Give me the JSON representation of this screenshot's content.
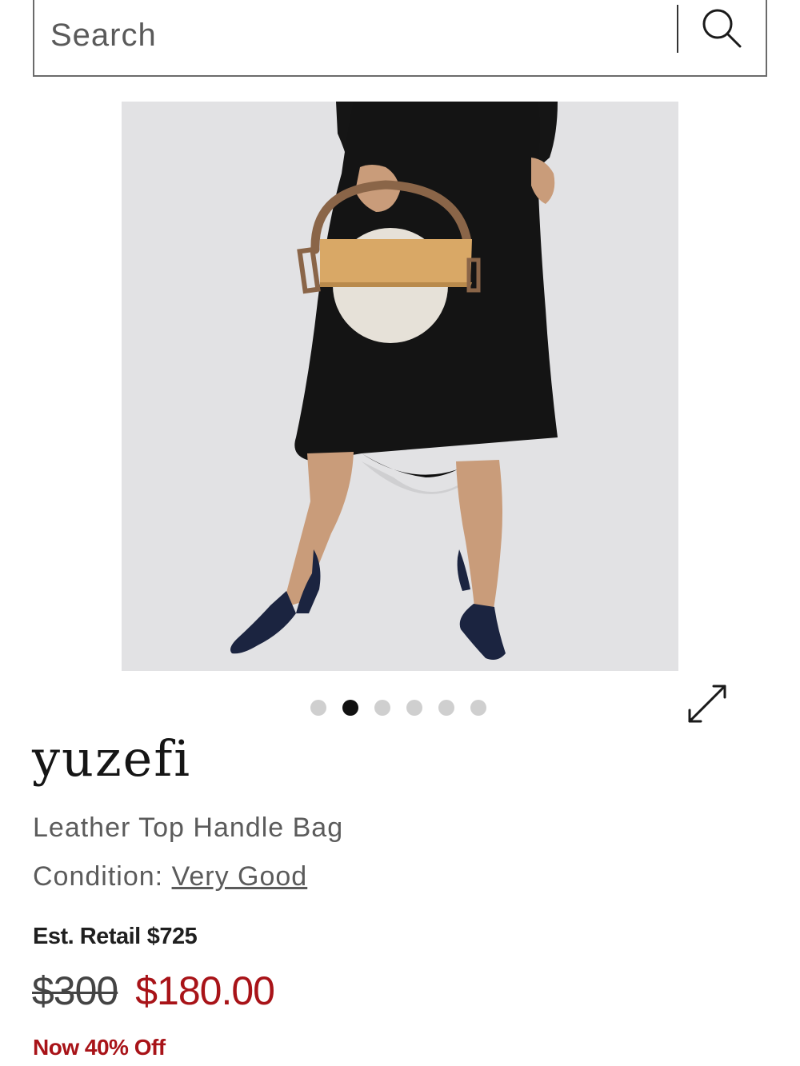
{
  "search": {
    "placeholder": "Search"
  },
  "carousel": {
    "total": 6,
    "active_index": 1
  },
  "product": {
    "brand": "yuzefi",
    "name": "Leather Top Handle Bag",
    "condition_label": "Condition:",
    "condition_value": "Very Good",
    "retail_label": "Est. Retail",
    "retail_price": "$725",
    "original_price": "$300",
    "sale_price": "$180.00",
    "discount_text": "Now 40% Off"
  },
  "colors": {
    "sale_red": "#a81318",
    "dot_active": "#111111",
    "dot_inactive": "#cfcfcf"
  },
  "icons": {
    "search": "search-icon",
    "expand": "expand-icon"
  }
}
